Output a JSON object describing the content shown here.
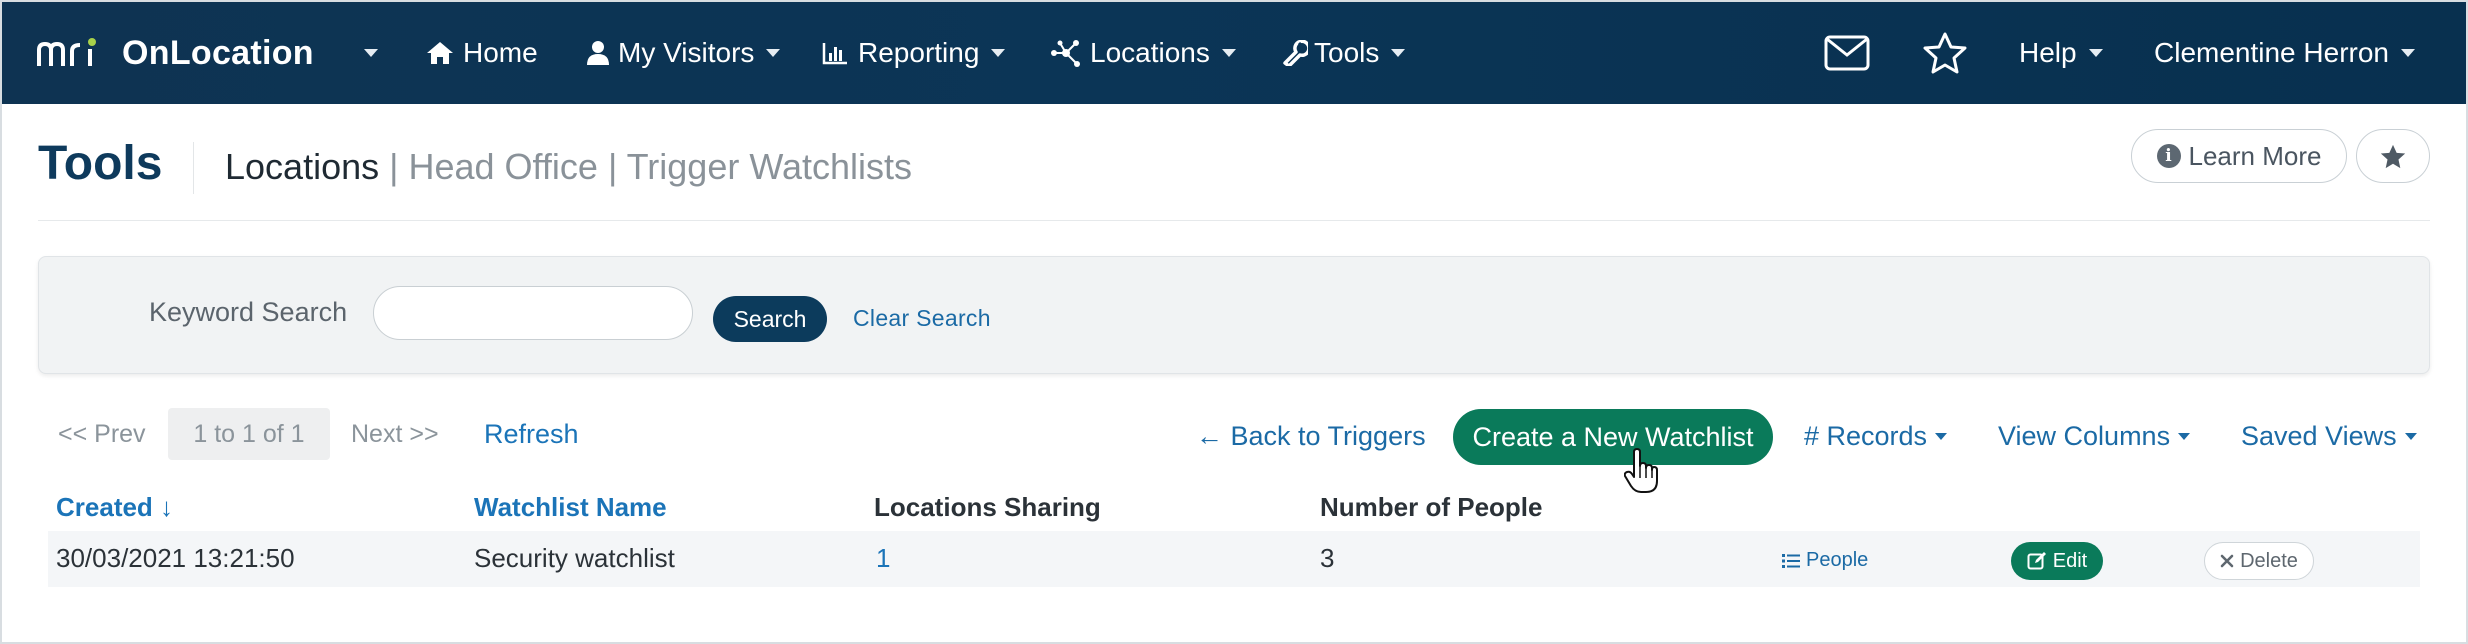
{
  "navbar": {
    "brand": "OnLocation",
    "items": [
      {
        "label": "Home",
        "icon": "home-icon"
      },
      {
        "label": "My Visitors",
        "icon": "user-icon"
      },
      {
        "label": "Reporting",
        "icon": "bar-chart-icon"
      },
      {
        "label": "Locations",
        "icon": "network-icon"
      },
      {
        "label": "Tools",
        "icon": "wrench-icon"
      }
    ],
    "help": "Help",
    "user": "Clementine Herron"
  },
  "header": {
    "title": "Tools",
    "crumb_main": "Locations",
    "crumb_1": "| Head Office",
    "crumb_2": "| Trigger Watchlists",
    "learn_more": "Learn More"
  },
  "search": {
    "label": "Keyword Search",
    "value": "",
    "button": "Search",
    "clear": "Clear Search"
  },
  "toolbar": {
    "prev": "<< Prev",
    "page_info": "1 to 1 of 1",
    "next": "Next >>",
    "refresh": "Refresh",
    "back": "← Back to Triggers",
    "create": "Create a New Watchlist",
    "records": "# Records",
    "view_columns": "View Columns",
    "saved_views": "Saved Views"
  },
  "table": {
    "columns": [
      "Created ↓",
      "Watchlist Name",
      "Locations Sharing",
      "Number of People"
    ],
    "rows": [
      {
        "created": "30/03/2021 13:21:50",
        "name": "Security watchlist",
        "locations_sharing": "1",
        "number_of_people": "3",
        "actions": {
          "people": "People",
          "edit": "Edit",
          "delete": "Delete"
        }
      }
    ]
  },
  "colors": {
    "navbar": "#0b3556",
    "primary_green": "#0a7a5a",
    "link_blue": "#1b74b8",
    "title_navy": "#0e3a5c"
  }
}
